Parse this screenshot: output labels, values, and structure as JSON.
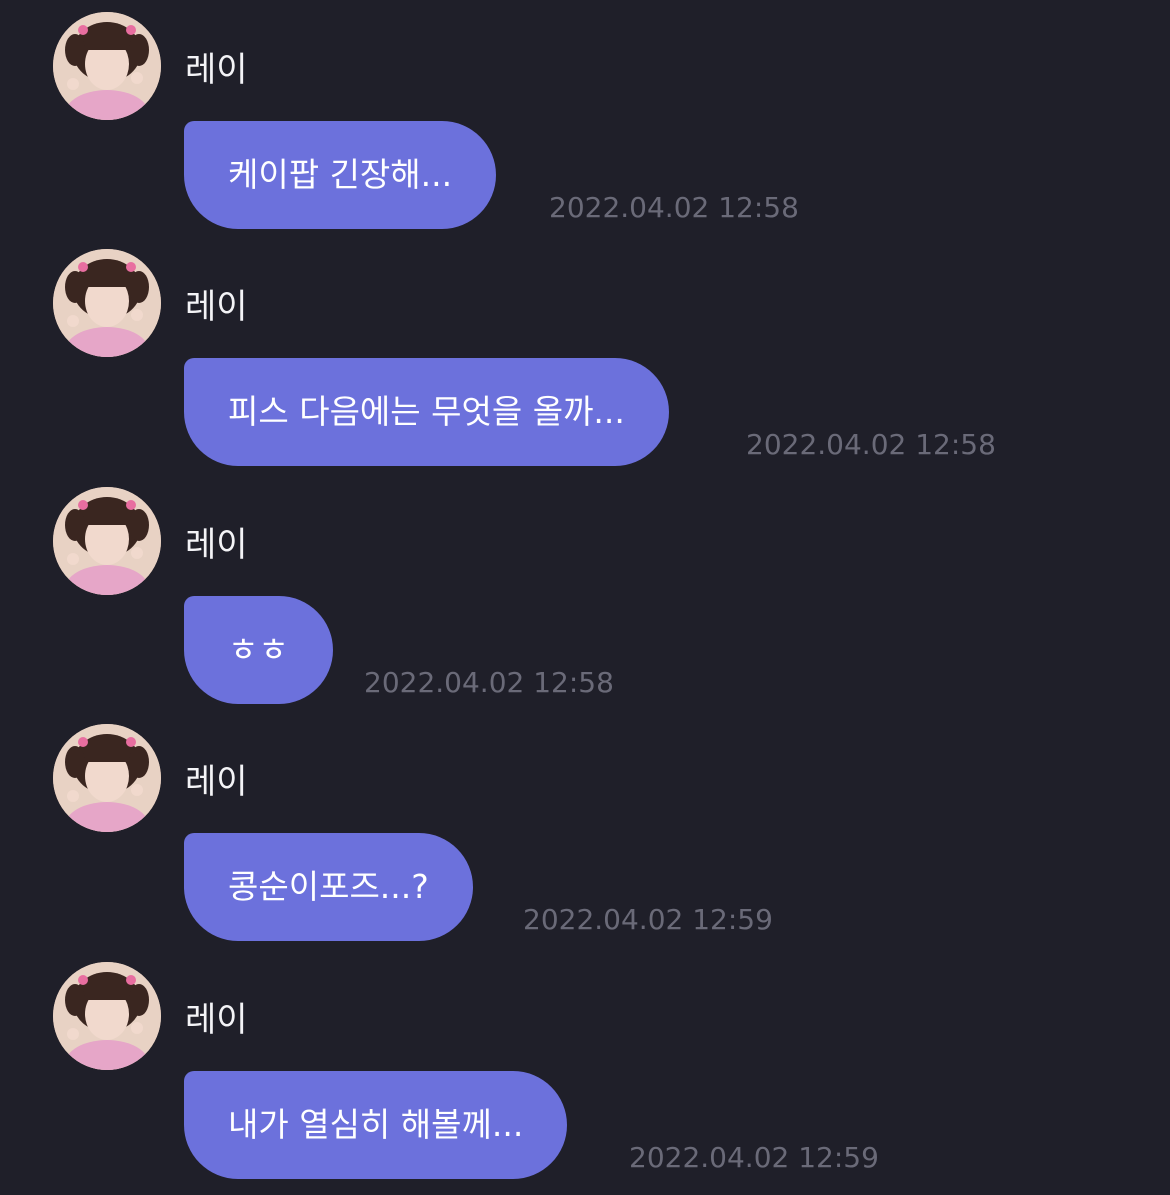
{
  "sender_name": "레이",
  "messages": [
    {
      "text": "케이팝 긴장해...",
      "time": "2022.04.02 12:58"
    },
    {
      "text": "피스 다음에는 무엇을 올까...",
      "time": "2022.04.02 12:58"
    },
    {
      "text": "ㅎㅎ",
      "time": "2022.04.02 12:58"
    },
    {
      "text": "콩순이포즈...?",
      "time": "2022.04.02 12:59"
    },
    {
      "text": "내가 열심히 해볼께...",
      "time": "2022.04.02 12:59"
    }
  ],
  "colors": {
    "background": "#1f1f29",
    "bubble": "#6c71dc",
    "sender_text": "#f3f3f6",
    "timestamp": "#6a6a78"
  },
  "icons": {
    "avatar": "profile-photo"
  }
}
